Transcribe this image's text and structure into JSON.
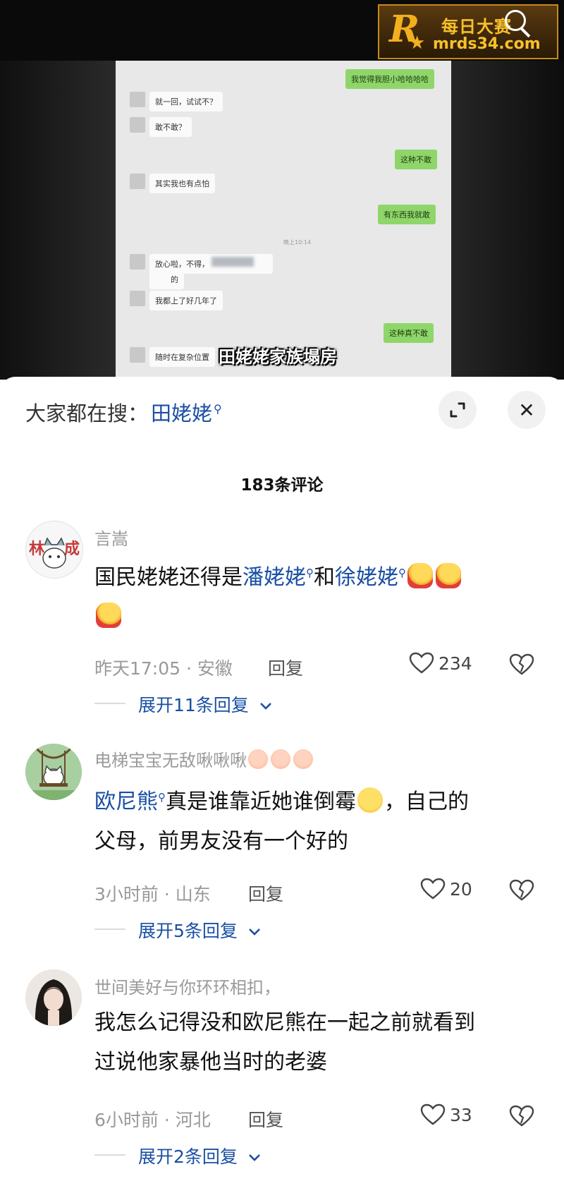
{
  "watermark": {
    "line1": "每日大赛",
    "line2": "mrds34.com",
    "logo_letter": "R",
    "logo_small": "每日大赛"
  },
  "video": {
    "caption": "田姥姥家族塌房",
    "chat": {
      "msg_out_1": "我觉得我胆小哈哈哈哈",
      "msg_in_1": "就一回，试试不？",
      "msg_in_2": "敢不敢？",
      "msg_out_2": "这种不敢",
      "msg_in_3": "其实我也有点怕",
      "msg_out_3": "有东西我就敢",
      "time": "晚上10:14",
      "msg_in_4a": "放心啦，不得，",
      "msg_in_4b": "的",
      "msg_in_5": "我都上了好几年了",
      "msg_out_4": "这种真不敢",
      "msg_in_6": "随时在复杂位置"
    }
  },
  "sheet": {
    "search_prefix": "大家都在搜：",
    "search_term": "田姥姥",
    "comment_count": "183条评论",
    "close_label": "✕"
  },
  "comments": [
    {
      "username": "言嵩",
      "text_a": "国民姥姥还得是",
      "kw1": "潘姥姥",
      "text_b": "和",
      "kw2": "徐姥姥",
      "meta": "昨天17:05 · 安徽",
      "reply": "回复",
      "likes": "234",
      "expand": "展开11条回复"
    },
    {
      "username": "电梯宝宝无敌啾啾啾",
      "kw1": "欧尼熊",
      "text_a": "真是谁靠近她谁倒霉",
      "text_b": "，自己的",
      "text_c": "父母，前男友没有一个好的",
      "meta": "3小时前 · 山东",
      "reply": "回复",
      "likes": "20",
      "expand": "展开5条回复"
    },
    {
      "username": "世间美好与你环环相扣，",
      "text_a": "我怎么记得没和欧尼熊在一起之前就看到",
      "text_b": "过说他家暴他当时的老婆",
      "meta": "6小时前 · 河北",
      "reply": "回复",
      "likes": "33",
      "expand": "展开2条回复"
    }
  ],
  "icons": {
    "search_suffix": "search-icon",
    "expand": "expand-icon",
    "close": "close-icon",
    "like": "heart-icon",
    "dislike": "broken-heart-icon",
    "chevron": "chevron-down-icon"
  },
  "colors": {
    "link": "#1a4fa3",
    "meta": "#999999",
    "bubble_out": "#8fd66a"
  }
}
